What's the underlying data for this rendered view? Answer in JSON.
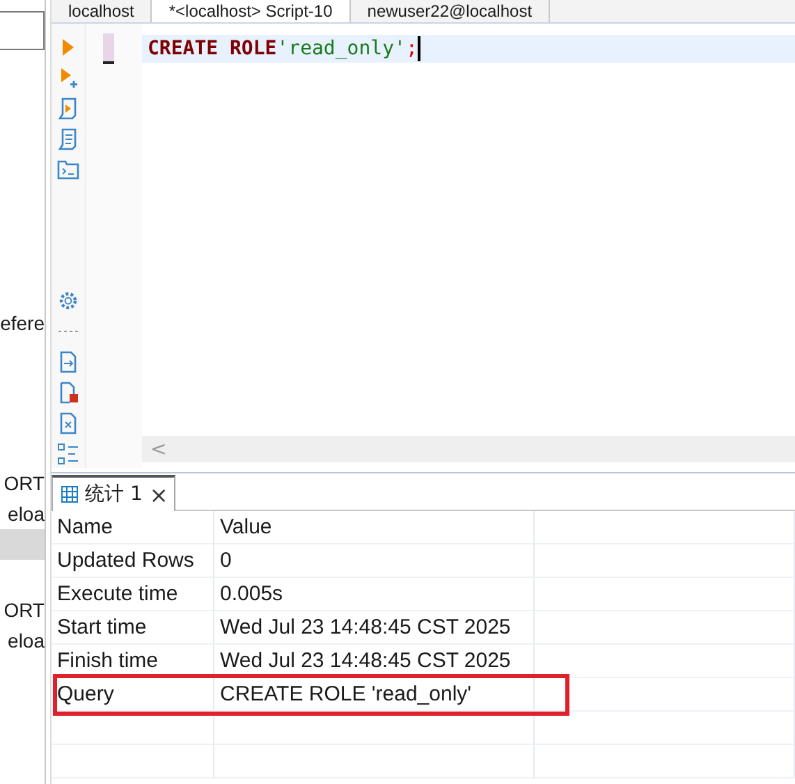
{
  "editor_tabs": [
    {
      "label": "localhost",
      "selected": false
    },
    {
      "label": "*<localhost> Script-10",
      "selected": true
    },
    {
      "label": "newuser22@localhost",
      "selected": false
    }
  ],
  "left_panel": {
    "items": [
      {
        "kind": "text",
        "text": "efere",
        "selected": false
      },
      {
        "kind": "text",
        "text": "ORT",
        "selected": false
      },
      {
        "kind": "text",
        "text": "eloa",
        "selected": false
      },
      {
        "kind": "blank",
        "selected": true
      },
      {
        "kind": "text",
        "text": "ORT",
        "selected": false
      },
      {
        "kind": "text",
        "text": "eloa",
        "selected": false
      }
    ]
  },
  "editor": {
    "tokens": [
      {
        "kind": "keyword",
        "text": "CREATE ROLE"
      },
      {
        "kind": "string",
        "text": "'read_only'"
      },
      {
        "kind": "punct",
        "text": ";"
      }
    ],
    "scroll_arrow": "<"
  },
  "results": {
    "tab": {
      "label": "统计 1",
      "close": "×",
      "selected": true
    },
    "columns": [
      "Name",
      "Value"
    ],
    "rows": [
      {
        "name": "Updated Rows",
        "value": "0",
        "highlighted": false
      },
      {
        "name": "Execute time",
        "value": "0.005s",
        "highlighted": false
      },
      {
        "name": "Start time",
        "value": "Wed Jul 23 14:48:45 CST 2025",
        "highlighted": false
      },
      {
        "name": "Finish time",
        "value": "Wed Jul 23 14:48:45 CST 2025",
        "highlighted": false
      },
      {
        "name": "Query",
        "value": "CREATE ROLE 'read_only'",
        "highlighted": true
      }
    ]
  }
}
